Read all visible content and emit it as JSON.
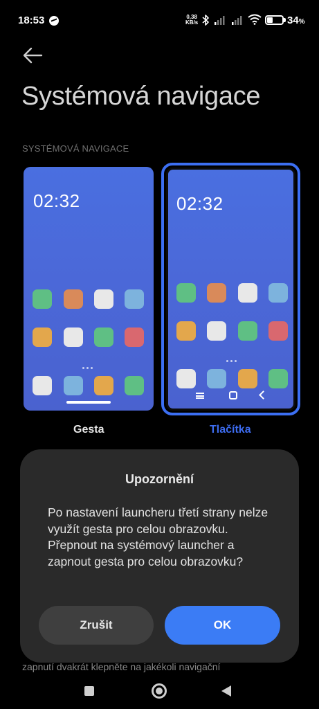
{
  "status_bar": {
    "time": "18:53",
    "net_speed_value": "0,38",
    "net_speed_unit": "KB/s",
    "battery_percent": "34",
    "battery_symbol": "%",
    "battery_level": 0.34,
    "icons": [
      "messenger-icon",
      "bluetooth-icon",
      "signal-icon",
      "signal-icon",
      "wifi-icon",
      "battery-icon"
    ]
  },
  "header": {
    "title": "Systémová navigace",
    "back_icon": "arrow-left-icon"
  },
  "section": {
    "label": "SYSTÉMOVÁ NAVIGACE"
  },
  "options": {
    "gestures": {
      "label": "Gesta",
      "clock": "02:32",
      "selected": false
    },
    "buttons": {
      "label": "Tlačítka",
      "clock": "02:32",
      "selected": true
    }
  },
  "background_hint": "zapnutí dvakrát klepněte na jakékoli navigační",
  "dialog": {
    "title": "Upozornění",
    "message": "Po nastavení launcheru třetí strany nelze využít gesta pro celou obrazovku. Přepnout na systémový launcher a zapnout gesta pro celou obrazovku?",
    "cancel_label": "Zrušit",
    "ok_label": "OK"
  },
  "colors": {
    "accent": "#3b7cf5",
    "selected_label": "#3d6cf0",
    "dialog_bg": "#2a2a2a",
    "app_icon_green": "#5fbf84",
    "app_icon_orange": "#d98a5a",
    "app_icon_white": "#e8e8e8",
    "app_icon_blue": "#7db3dd",
    "app_icon_yellow": "#e3a74c",
    "app_icon_red": "#d9686f"
  },
  "system_nav": {
    "icons": [
      "recents-icon",
      "home-icon",
      "back-icon"
    ]
  }
}
